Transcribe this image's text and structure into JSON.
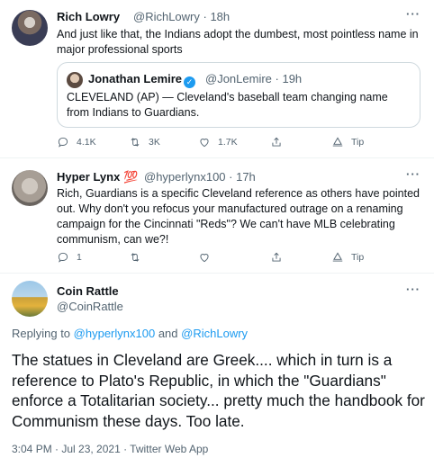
{
  "tweet1": {
    "name": "Rich Lowry",
    "handle": "@RichLowry",
    "time": "18h",
    "more": "···",
    "text": "And just like that, the Indians adopt the dumbest, most pointless name in major professional sports",
    "quote": {
      "name": "Jonathan Lemire",
      "handle": "@JonLemire",
      "time": "19h",
      "text": "CLEVELAND (AP) — Cleveland's baseball team changing name from Indians to Guardians."
    },
    "actions": {
      "replies": "4.1K",
      "retweets": "3K",
      "likes": "1.7K",
      "tip": "Tip"
    }
  },
  "tweet2": {
    "name": "Hyper Lynx",
    "emoji": "💯",
    "handle": "@hyperlynx100",
    "time": "17h",
    "more": "···",
    "text": "Rich, Guardians is a specific Cleveland reference as others have pointed out. Why don't you refocus your manufactured outrage on a renaming campaign for the Cincinnati \"Reds\"? We can't have MLB celebrating communism, can we?!",
    "actions": {
      "replies": "1",
      "tip": "Tip"
    }
  },
  "tweet3": {
    "name": "Coin Rattle",
    "handle": "@CoinRattle",
    "more": "···",
    "replying_prefix": "Replying to",
    "reply_user1": "@hyperlynx100",
    "reply_and": "and",
    "reply_user2": "@RichLowry",
    "text": "The statues in Cleveland are Greek.... which in turn is a reference to Plato's Republic, in which the \"Guardians\" enforce a Totalitarian society... pretty much the handbook for Communism these days. Too late.",
    "timestamp": "3:04 PM · Jul 23, 2021 · Twitter Web App"
  },
  "colors": {
    "accent": "#1d9bf0",
    "muted": "#536471",
    "text": "#0f1419",
    "border": "#cfd9de"
  }
}
